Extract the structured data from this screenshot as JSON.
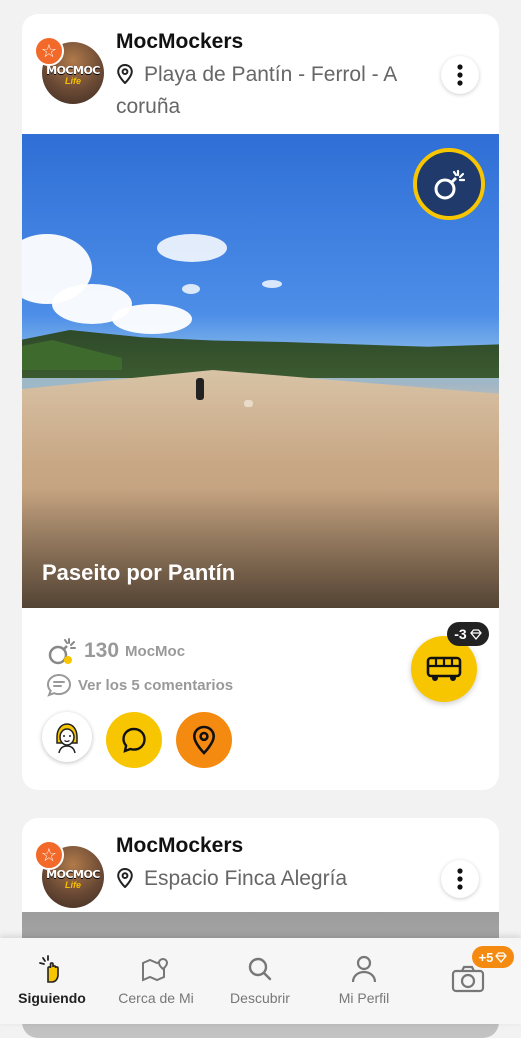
{
  "posts": [
    {
      "username": "MocMockers",
      "location": "Playa de Pantín - Ferrol - A coruña",
      "photo_title": "Paseito por Pantín",
      "mocmoc_count": "130",
      "mocmoc_label": "MocMoc",
      "comments_link": "Ver los 5 comentarios",
      "avatar_logo": "MOCMOC",
      "avatar_sub": "Life",
      "cost_badge": "-3"
    },
    {
      "username": "MocMockers",
      "location": "Espacio Finca Alegría",
      "avatar_logo": "MOCMOC",
      "avatar_sub": "Life"
    }
  ],
  "nav": {
    "items": [
      {
        "label": "Siguiendo",
        "icon": "following-hand-icon",
        "active": true
      },
      {
        "label": "Cerca de Mi",
        "icon": "map-pin-icon"
      },
      {
        "label": "Descubrir",
        "icon": "search-icon"
      },
      {
        "label": "Mi Perfil",
        "icon": "user-icon"
      }
    ],
    "camera_badge": "+5"
  },
  "colors": {
    "accent_yellow": "#f7c600",
    "accent_orange": "#f58a10",
    "star_orange": "#f2692a",
    "navy": "#1f3a6b"
  }
}
